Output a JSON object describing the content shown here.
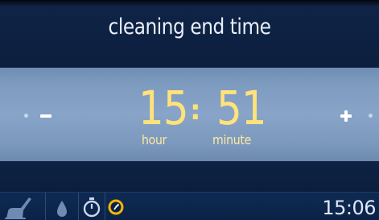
{
  "screen": {
    "title": "cleaning end time"
  },
  "time_setting": {
    "hour": "15",
    "separator": ":",
    "minute": "51",
    "hour_unit": "hour",
    "minute_unit": "minute",
    "decrease_icon": "minus-icon",
    "increase_icon": "plus-icon"
  },
  "status_bar": {
    "icons": [
      "cleaning-wipe-icon",
      "drop-icon",
      "timer-icon",
      "end-time-clock-icon"
    ],
    "clock": "15:06"
  },
  "colors": {
    "background": "#0c1f3f",
    "band": "#88a4c8",
    "time_text": "#ffe27a",
    "active_icon": "#f2b705"
  }
}
